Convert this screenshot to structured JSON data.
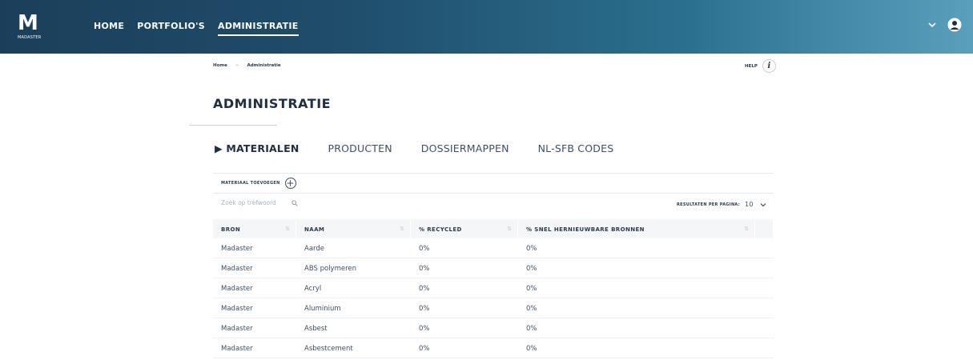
{
  "brand": {
    "mark": "M",
    "name": "MADASTER"
  },
  "nav": {
    "items": [
      {
        "label": "HOME",
        "active": false
      },
      {
        "label": "PORTFOLIO'S",
        "active": false
      },
      {
        "label": "ADMINISTRATIE",
        "active": true
      }
    ]
  },
  "top_right": {
    "dropdown_icon": "chevron-down-icon",
    "user_icon": "user-icon"
  },
  "breadcrumb": {
    "items": [
      "Home",
      "Administratie"
    ],
    "separator": ">"
  },
  "help": {
    "label": "HELP",
    "icon": "i"
  },
  "page": {
    "title": "ADMINISTRATIE"
  },
  "tabs": [
    {
      "label": "▶ MATERIALEN",
      "active": true
    },
    {
      "label": "PRODUCTEN",
      "active": false
    },
    {
      "label": "DOSSIERMAPPEN",
      "active": false
    },
    {
      "label": "NL-SFB CODES",
      "active": false
    }
  ],
  "toolbar": {
    "add_label": "MATERIAAL TOEVOEGEN",
    "search_placeholder": "Zoek op trefwoord",
    "per_page_label": "RESULTATEN PER PAGINA:",
    "per_page_value": "10"
  },
  "table": {
    "columns": [
      {
        "label": "BRON",
        "sort": "⇅"
      },
      {
        "label": "NAAM",
        "sort": "⇅"
      },
      {
        "label": "% RECYCLED",
        "sort": "⇅"
      },
      {
        "label": "% SNEL HERNIEUWBARE BRONNEN",
        "sort": "⇅"
      }
    ],
    "rows": [
      [
        "Madaster",
        "Aarde",
        "0%",
        "0%"
      ],
      [
        "Madaster",
        "ABS polymeren",
        "0%",
        "0%"
      ],
      [
        "Madaster",
        "Acryl",
        "0%",
        "0%"
      ],
      [
        "Madaster",
        "Aluminium",
        "0%",
        "0%"
      ],
      [
        "Madaster",
        "Asbest",
        "0%",
        "0%"
      ],
      [
        "Madaster",
        "Asbestcement",
        "0%",
        "0%"
      ]
    ]
  },
  "colors": {
    "header_start": "#1b3f5a",
    "header_end": "#5aa0bd",
    "text": "#2b3a4a",
    "table_head_bg": "#f4f6f8"
  }
}
